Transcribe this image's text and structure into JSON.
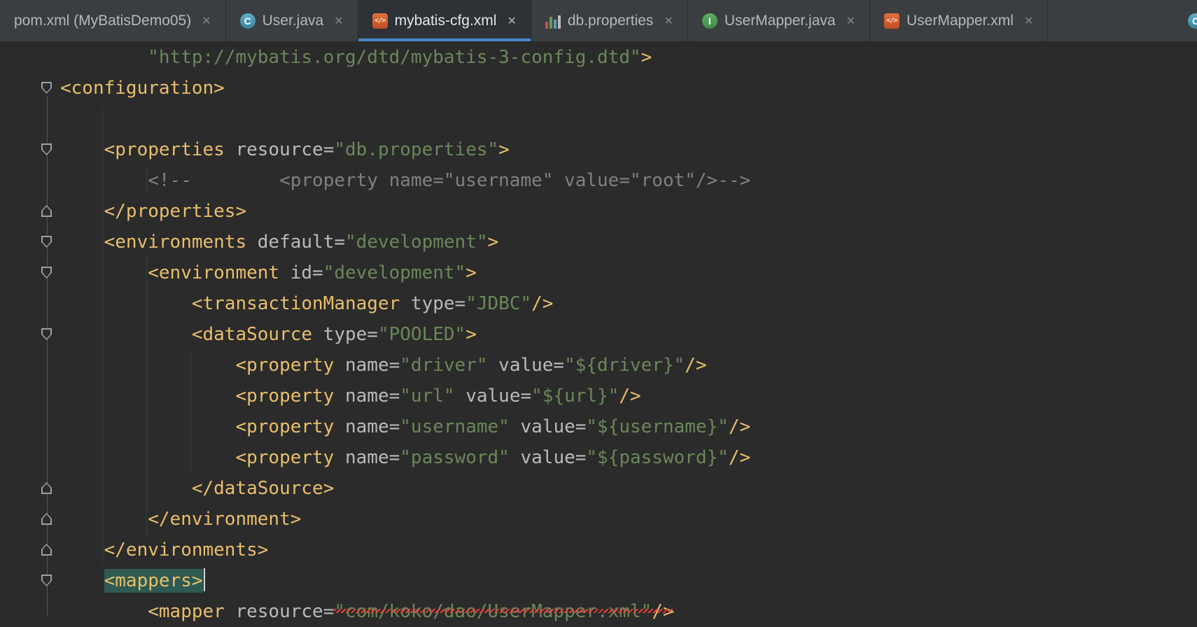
{
  "colors": {
    "editor_bg": "#2b2b2b",
    "tabbar_bg": "#3b3e40",
    "active_tab_bg": "#2d3236",
    "active_tab_underline": "#4a88c7",
    "tag": "#e8bf6a",
    "attribute": "#bababa",
    "string": "#6a8759",
    "comment": "#808080",
    "plain_text": "#a9b7c6",
    "tag_match_highlight": "#2e5a52",
    "error_underline": "#e8423c",
    "class_icon": "#3f94ad",
    "interface_icon": "#499c54",
    "xml_icon": "#d35f2f"
  },
  "editor_tabs": {
    "close_glyph": "✕",
    "xml_icon_glyph": "</>",
    "properties_icon_bars": [
      {
        "h": 10,
        "c": "#c75450"
      },
      {
        "h": 17,
        "c": "#5f9e5a"
      },
      {
        "h": 13,
        "c": "#6897bb"
      },
      {
        "h": 19,
        "c": "#bdbdbd"
      }
    ],
    "clipped_tab_icon": {
      "type": "class",
      "letter": "C"
    },
    "tabs": [
      {
        "label": "pom.xml (MyBatisDemo05)",
        "icon": "none",
        "active": false
      },
      {
        "label": "User.java",
        "icon": "class",
        "icon_letter": "C",
        "active": false
      },
      {
        "label": "mybatis-cfg.xml",
        "icon": "xml",
        "active": true
      },
      {
        "label": "db.properties",
        "icon": "properties",
        "active": false
      },
      {
        "label": "UserMapper.java",
        "icon": "interface",
        "icon_letter": "I",
        "active": false
      },
      {
        "label": "UserMapper.xml",
        "icon": "xml",
        "active": false
      }
    ]
  },
  "code": {
    "lines": [
      {
        "indent": 8,
        "tokens": [
          [
            "s",
            "\"http://mybatis.org/dtd/mybatis-3-config.dtd\""
          ],
          [
            "t",
            ">"
          ]
        ]
      },
      {
        "indent": 0,
        "tokens": [
          [
            "t",
            "<configuration>"
          ]
        ],
        "fold": "start"
      },
      {
        "indent": 0,
        "tokens": []
      },
      {
        "indent": 4,
        "tokens": [
          [
            "t",
            "<properties "
          ],
          [
            "a",
            "resource="
          ],
          [
            "s",
            "\"db.properties\""
          ],
          [
            "t",
            ">"
          ]
        ],
        "fold": "start"
      },
      {
        "indent": 8,
        "tokens": [
          [
            "c",
            "<!--        <property name=\"username\" value=\"root\"/>-->"
          ]
        ]
      },
      {
        "indent": 4,
        "tokens": [
          [
            "t",
            "</properties>"
          ]
        ],
        "fold": "end"
      },
      {
        "indent": 4,
        "tokens": [
          [
            "t",
            "<environments "
          ],
          [
            "a",
            "default="
          ],
          [
            "s",
            "\"development\""
          ],
          [
            "t",
            ">"
          ]
        ],
        "fold": "start"
      },
      {
        "indent": 8,
        "tokens": [
          [
            "t",
            "<environment "
          ],
          [
            "a",
            "id="
          ],
          [
            "s",
            "\"development\""
          ],
          [
            "t",
            ">"
          ]
        ],
        "fold": "start"
      },
      {
        "indent": 12,
        "tokens": [
          [
            "t",
            "<transactionManager "
          ],
          [
            "a",
            "type="
          ],
          [
            "s",
            "\"JDBC\""
          ],
          [
            "t",
            "/>"
          ]
        ]
      },
      {
        "indent": 12,
        "tokens": [
          [
            "t",
            "<dataSource "
          ],
          [
            "a",
            "type="
          ],
          [
            "s",
            "\"POOLED\""
          ],
          [
            "t",
            ">"
          ]
        ],
        "fold": "start"
      },
      {
        "indent": 16,
        "tokens": [
          [
            "t",
            "<property "
          ],
          [
            "a",
            "name="
          ],
          [
            "s",
            "\"driver\""
          ],
          [
            "a",
            " value="
          ],
          [
            "s",
            "\"${driver}\""
          ],
          [
            "t",
            "/>"
          ]
        ]
      },
      {
        "indent": 16,
        "tokens": [
          [
            "t",
            "<property "
          ],
          [
            "a",
            "name="
          ],
          [
            "s",
            "\"url\""
          ],
          [
            "a",
            " value="
          ],
          [
            "s",
            "\"${url}\""
          ],
          [
            "t",
            "/>"
          ]
        ]
      },
      {
        "indent": 16,
        "tokens": [
          [
            "t",
            "<property "
          ],
          [
            "a",
            "name="
          ],
          [
            "s",
            "\"username\""
          ],
          [
            "a",
            " value="
          ],
          [
            "s",
            "\"${username}\""
          ],
          [
            "t",
            "/>"
          ]
        ]
      },
      {
        "indent": 16,
        "tokens": [
          [
            "t",
            "<property "
          ],
          [
            "a",
            "name="
          ],
          [
            "s",
            "\"password\""
          ],
          [
            "a",
            " value="
          ],
          [
            "s",
            "\"${password}\""
          ],
          [
            "t",
            "/>"
          ]
        ]
      },
      {
        "indent": 12,
        "tokens": [
          [
            "t",
            "</dataSource>"
          ]
        ],
        "fold": "end"
      },
      {
        "indent": 8,
        "tokens": [
          [
            "t",
            "</environment>"
          ]
        ],
        "fold": "end"
      },
      {
        "indent": 4,
        "tokens": [
          [
            "t",
            "</environments>"
          ]
        ],
        "fold": "end"
      },
      {
        "indent": 4,
        "tokens": [
          [
            "t",
            "<mappers>"
          ]
        ],
        "fold": "start",
        "highlight": true,
        "caret_after": true
      },
      {
        "indent": 8,
        "tokens": [
          [
            "t",
            "<mapper "
          ],
          [
            "a",
            "resource="
          ],
          [
            "s",
            "\"com/koko/dao/UserMapper.xml\"",
            "err"
          ],
          [
            "t",
            "/>",
            "err"
          ]
        ]
      }
    ]
  }
}
